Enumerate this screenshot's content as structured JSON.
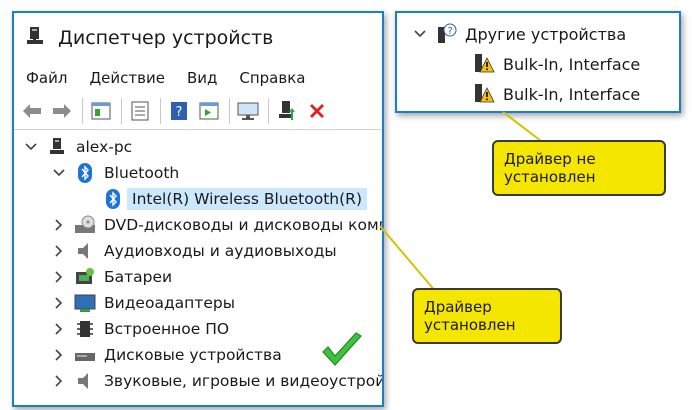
{
  "main_window": {
    "title": "Диспетчер устройств",
    "menu": [
      "Файл",
      "Действие",
      "Вид",
      "Справка"
    ],
    "toolbar_icons": [
      "back-icon",
      "forward-icon",
      "properties-icon",
      "list-icon",
      "help-icon",
      "view-icon",
      "scan-icon",
      "update-driver-icon",
      "uninstall-icon"
    ],
    "tree": {
      "computer": "alex-pc",
      "bluetooth": "Bluetooth",
      "bluetooth_device": "Intel(R) Wireless Bluetooth(R)",
      "categories": [
        "DVD-дисководы и дисководы компакт-дисков",
        "Аудиовходы и аудиовыходы",
        "Батареи",
        "Видеоадаптеры",
        "Встроенное ПО",
        "Дисковые устройства",
        "Звуковые, игровые и видеоустройства"
      ]
    }
  },
  "other_window": {
    "category": "Другие устройства",
    "devices": [
      "Bulk-In, Interface",
      "Bulk-In, Interface"
    ]
  },
  "callouts": {
    "not_installed": "Драйвер не установлен",
    "installed": "Драйвер установлен"
  },
  "colors": {
    "accent": "#1a7ec8",
    "callout": "#f5e600",
    "selection": "#cce8ff",
    "check": "#3cc23c"
  }
}
